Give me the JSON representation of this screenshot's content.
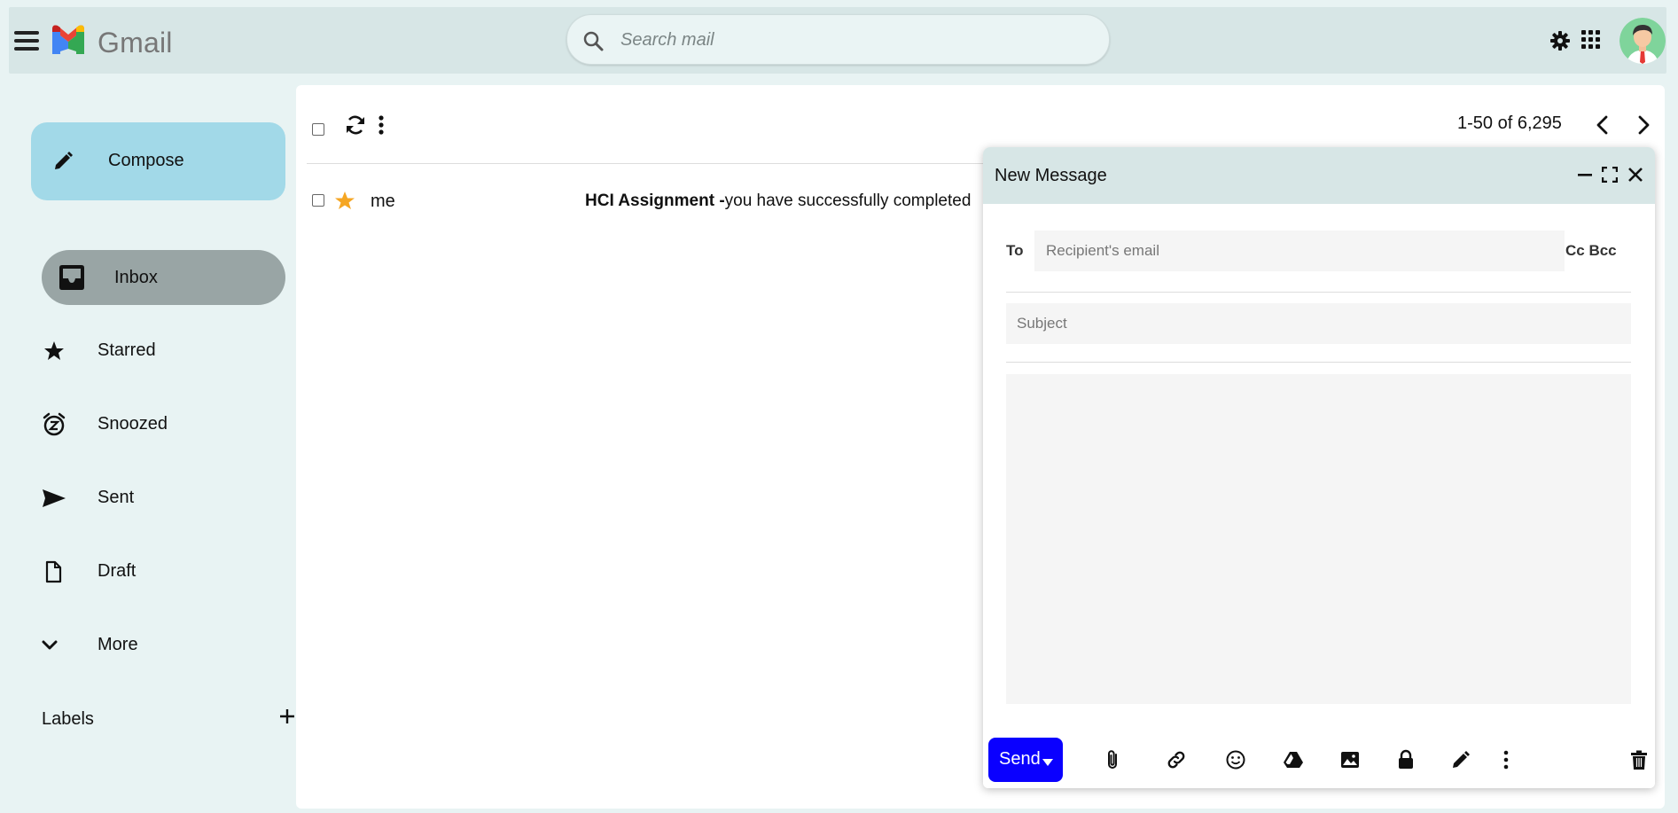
{
  "header": {
    "brand": "Gmail",
    "search_placeholder": "Search mail",
    "icons": [
      "hamburger-icon",
      "gmail-logo",
      "search-icon",
      "gear-icon",
      "apps-grid-icon",
      "avatar"
    ]
  },
  "sidebar": {
    "compose_label": "Compose",
    "items": [
      {
        "label": "Inbox",
        "icon": "inbox-icon",
        "active": true
      },
      {
        "label": "Starred",
        "icon": "star-icon"
      },
      {
        "label": "Snoozed",
        "icon": "snooze-clock-icon"
      },
      {
        "label": "Sent",
        "icon": "send-icon"
      },
      {
        "label": "Draft",
        "icon": "draft-file-icon"
      },
      {
        "label": "More",
        "icon": "chevron-down-icon"
      }
    ],
    "labels_title": "Labels"
  },
  "toolbar": {
    "pager": "1-50 of 6,295"
  },
  "emails": [
    {
      "sender": "me",
      "subject": "HCI Assignment -",
      "snippet": "you have successfully completed",
      "starred": true
    }
  ],
  "compose": {
    "title": "New Message",
    "to_label": "To",
    "to_placeholder": "Recipient's email",
    "cc_bcc": "Cc Bcc",
    "subject_placeholder": "Subject",
    "send_label": "Send",
    "tools": [
      "attach-icon",
      "link-icon",
      "emoji-icon",
      "drive-icon",
      "photo-icon",
      "lock-icon",
      "signature-pen-icon",
      "more-options-icon",
      "trash-icon"
    ]
  },
  "colors": {
    "page_bg": "#e8f3f3",
    "topbar_bg": "#d7e6e6",
    "compose_button": "#a2d9e8",
    "inbox_active": "#99a5a5",
    "send_button": "#0a00ff",
    "star": "#f5a623"
  }
}
